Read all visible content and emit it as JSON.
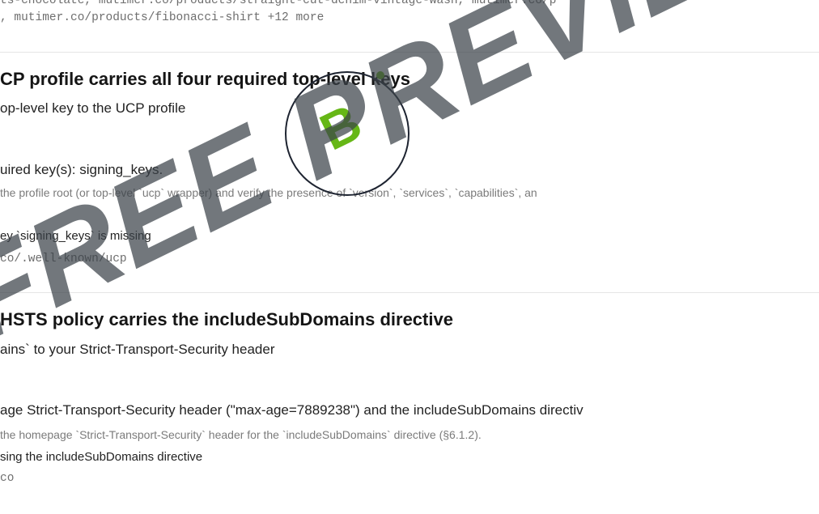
{
  "top_urls": {
    "line1": "ts-chocolate, mutimer.co/products/straight-cut-denim-vintage-wash, mutimer.co/p",
    "line2": ", mutimer.co/products/fibonacci-shirt +12 more"
  },
  "check1": {
    "title": "CP profile carries all four required top-level keys",
    "fix": "op-level key to the UCP profile",
    "detail": "uired key(s): signing_keys.",
    "how": "the profile root (or top-level `ucp` wrapper) and verify the presence of `version`, `services`, `capabilities`, an",
    "evidence": "ey `signing_keys` is missing",
    "url": "co/.well-known/ucp"
  },
  "check2": {
    "title": "HSTS policy carries the includeSubDomains directive",
    "fix": "ains` to your Strict-Transport-Security header",
    "detail": "age Strict-Transport-Security header (\"max-age=7889238\") and the includeSubDomains directiv",
    "how": "the homepage `Strict-Transport-Security` header for the `includeSubDomains` directive (§6.1.2).",
    "evidence": "sing the includeSubDomains directive",
    "url": "co"
  },
  "grade_badge": {
    "letter": "B"
  },
  "watermark": "FREE PREVIEW",
  "colors": {
    "badge_green": "#66b716",
    "badge_border": "#1e2431",
    "watermark": "#3c424a"
  }
}
